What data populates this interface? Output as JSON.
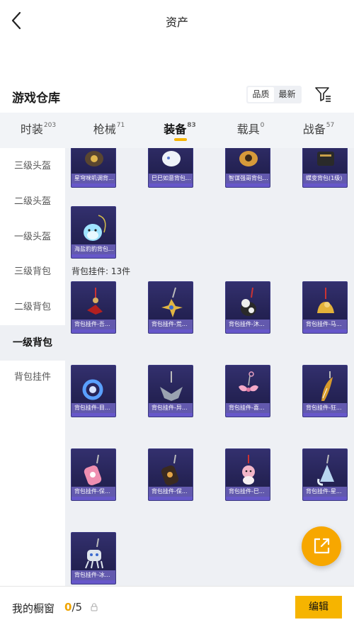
{
  "header": {
    "title": "资产"
  },
  "section": {
    "title": "游戏仓库",
    "sort_options": [
      "品质",
      "最新"
    ]
  },
  "tabs": [
    {
      "label": "时装",
      "count": "203"
    },
    {
      "label": "枪械",
      "count": "71"
    },
    {
      "label": "装备",
      "count": "83"
    },
    {
      "label": "载具",
      "count": "0"
    },
    {
      "label": "战备",
      "count": "57"
    }
  ],
  "active_tab": 2,
  "sidebar": {
    "items": [
      "三级头盔",
      "二级头盔",
      "一级头盔",
      "三级背包",
      "二级背包",
      "一级背包",
      "背包挂件"
    ],
    "active": 5
  },
  "grid": {
    "top_row": [
      "星穹咪叽调背...",
      "巳巳如意背包...",
      "智谋强哥背包...",
      "蝶变背包(1级)"
    ],
    "single_item": "海盐豹豹背包...",
    "group_label": "背包挂件: 13件",
    "pendants": [
      "背包挂件-吾...",
      "背包挂件-荒...",
      "背包挂件-沐...",
      "背包挂件-马...",
      "背包挂件-目...",
      "背包挂件-异...",
      "背包挂件-喜...",
      "背包挂件-狂...",
      "背包挂件-保...",
      "背包挂件-保...",
      "背包挂件-巳...",
      "背包挂件-星...",
      "背包挂件-冰..."
    ]
  },
  "footer": {
    "label": "我的橱窗",
    "count_current": "0",
    "count_total": "/5",
    "edit_label": "编辑"
  },
  "colors": {
    "accent": "#f6b400",
    "card_bg": "#2a285e",
    "content_bg": "#eef0f4"
  }
}
